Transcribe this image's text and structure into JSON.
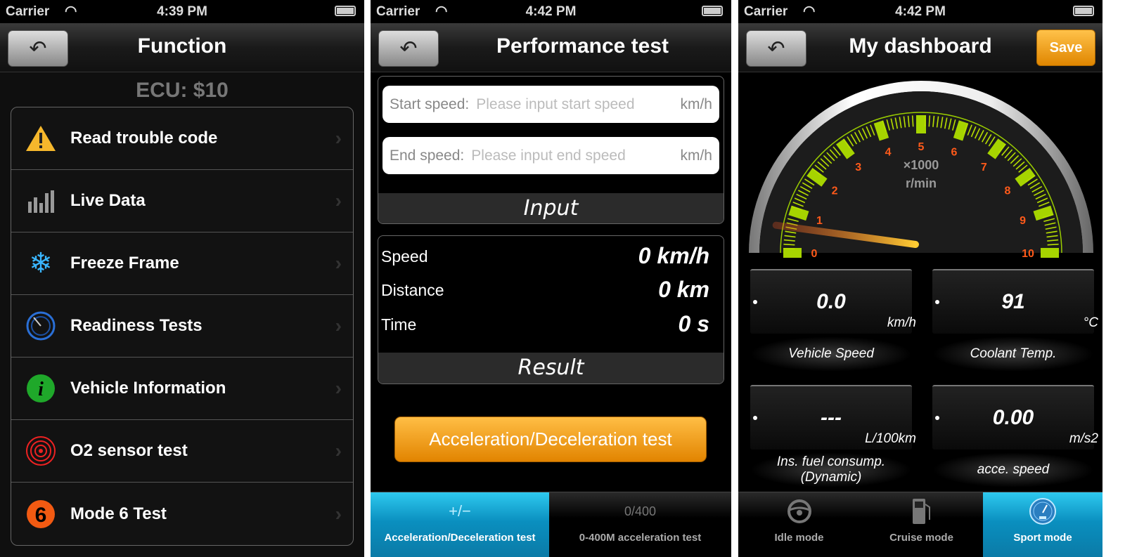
{
  "status": [
    {
      "carrier": "Carrier",
      "time": "4:39 PM"
    },
    {
      "carrier": "Carrier",
      "time": "4:42 PM"
    },
    {
      "carrier": "Carrier",
      "time": "4:42 PM"
    }
  ],
  "function": {
    "title": "Function",
    "ecu": "ECU: $10",
    "items": [
      {
        "label": "Read trouble code",
        "icon": "warning-icon"
      },
      {
        "label": "Live Data",
        "icon": "bar-chart-icon"
      },
      {
        "label": "Freeze Frame",
        "icon": "snowflake-icon"
      },
      {
        "label": "Readiness Tests",
        "icon": "timer-icon"
      },
      {
        "label": "Vehicle Information",
        "icon": "info-icon"
      },
      {
        "label": "O2 sensor test",
        "icon": "target-icon"
      },
      {
        "label": "Mode 6 Test",
        "icon": "six-icon"
      }
    ]
  },
  "performance": {
    "title": "Performance test",
    "start": {
      "label": "Start speed:",
      "placeholder": "Please input start speed",
      "unit": "km/h"
    },
    "end": {
      "label": "End speed:",
      "placeholder": "Please input end speed",
      "unit": "km/h"
    },
    "input_label": "Input",
    "results": [
      {
        "label": "Speed",
        "value": "0 km/h"
      },
      {
        "label": "Distance",
        "value": "0 km"
      },
      {
        "label": "Time",
        "value": "0 s"
      }
    ],
    "result_label": "Result",
    "button": "Acceleration/Deceleration test",
    "tabs": [
      {
        "glyph": "+/−",
        "label": "Acceleration/Deceleration test",
        "active": true
      },
      {
        "glyph": "0/400",
        "label": "0-400M acceleration test",
        "active": false
      }
    ]
  },
  "dashboard": {
    "title": "My dashboard",
    "save": "Save",
    "gauge": {
      "unit_line1": "×1000",
      "unit_line2": "r/min",
      "min": 0,
      "max": 10,
      "value": 0.6,
      "labels": [
        "0",
        "1",
        "2",
        "3",
        "4",
        "5",
        "6",
        "7",
        "8",
        "9",
        "10"
      ]
    },
    "tiles": [
      {
        "value": "0.0",
        "unit": "km/h",
        "name": "Vehicle Speed"
      },
      {
        "value": "91",
        "unit": "°C",
        "name": "Coolant Temp."
      },
      {
        "value": "---",
        "unit": "L/100km",
        "name": "Ins. fuel consump. (Dynamic)"
      },
      {
        "value": "0.00",
        "unit": "m/s2",
        "name": "acce. speed"
      }
    ],
    "tabs": [
      {
        "label": "Idle mode",
        "icon": "steering-wheel-icon",
        "active": false
      },
      {
        "label": "Cruise mode",
        "icon": "fuel-pump-icon",
        "active": false
      },
      {
        "label": "Sport mode",
        "icon": "speedometer-icon",
        "active": true
      }
    ]
  },
  "colors": {
    "accent_orange": "#f29a12",
    "tab_active": "#1aa8d8",
    "gauge_green": "#9acd00",
    "gauge_label": "#ff5a1a"
  }
}
